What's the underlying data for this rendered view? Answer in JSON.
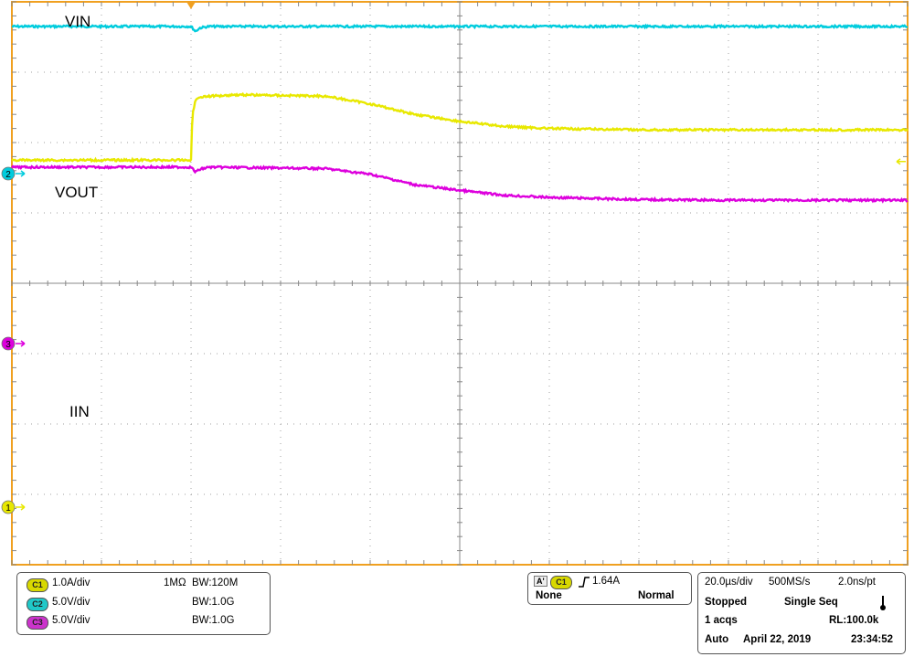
{
  "chart_data": {
    "type": "line",
    "title": "",
    "xlabel": "",
    "ylabel": "",
    "x_unit": "µs",
    "xlim": [
      -40,
      160
    ],
    "ylim_div": [
      -4,
      4
    ],
    "grid": true,
    "series": [
      {
        "name": "VIN",
        "channel": "C2",
        "color": "#00ccdd",
        "x": [
          -40,
          0,
          1,
          2,
          4,
          160
        ],
        "y": [
          3.65,
          3.65,
          3.58,
          3.63,
          3.65,
          3.65
        ]
      },
      {
        "name": "VOUT",
        "channel": "C3",
        "color": "#dd00dd",
        "x": [
          -40,
          0,
          1,
          2,
          4,
          30,
          40,
          50,
          60,
          70,
          80,
          100,
          120,
          160
        ],
        "y": [
          1.65,
          1.65,
          1.58,
          1.62,
          1.65,
          1.63,
          1.55,
          1.4,
          1.32,
          1.25,
          1.22,
          1.19,
          1.18,
          1.18
        ]
      },
      {
        "name": "IIN",
        "channel": "C1",
        "color": "#e8e800",
        "x": [
          -40,
          0,
          0.3,
          1,
          2,
          10,
          30,
          40,
          50,
          60,
          70,
          80,
          100,
          120,
          160
        ],
        "y": [
          1.75,
          1.75,
          2.4,
          2.6,
          2.65,
          2.68,
          2.66,
          2.55,
          2.4,
          2.3,
          2.23,
          2.2,
          2.18,
          2.18,
          2.18
        ]
      }
    ],
    "trace_labels": [
      "VIN",
      "VOUT",
      "IIN"
    ]
  },
  "markers": {
    "ch2": "2",
    "ch3": "3",
    "ch1": "1"
  },
  "colors": {
    "frame": "#f0a020",
    "grid": "#a0a0a0",
    "ch1": "#e8e800",
    "ch2": "#00ccdd",
    "ch3": "#dd00dd",
    "pill1": "#d8d800",
    "pill2": "#20c8c8",
    "pill3": "#cc33cc"
  },
  "channels_panel": {
    "rows": [
      {
        "pill": "C1",
        "scale": "1.0A/div",
        "impedance": "1MΩ",
        "bw": "W:120M"
      },
      {
        "pill": "C2",
        "scale": "5.0V/div",
        "impedance": "",
        "bw": "W:1.0G"
      },
      {
        "pill": "C3",
        "scale": "5.0V/div",
        "impedance": "",
        "bw": "W:1.0G"
      }
    ],
    "bw_prefix": "B"
  },
  "trigger_panel": {
    "a_label": "A'",
    "source": "C1",
    "level": "1.64A",
    "coupling": "None",
    "mode": "Normal"
  },
  "acq_panel": {
    "timebase": "20.0µs/div",
    "sample_rate": "500MS/s",
    "resolution": "2.0ns/pt",
    "state": "Stopped",
    "seq_mode": "Single Seq",
    "acqs": "1 acqs",
    "record_length": "RL:100.0k",
    "auto": "Auto",
    "date": "April 22, 2019",
    "time": "23:34:52"
  }
}
